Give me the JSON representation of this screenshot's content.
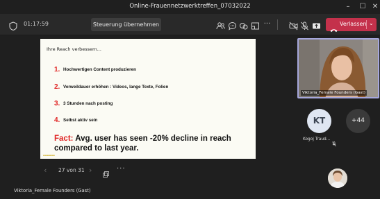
{
  "window": {
    "title": "Online-Frauennetzwerktreffen_07032022",
    "minimize": "–",
    "maximize": "☐",
    "close": "✕"
  },
  "toolbar": {
    "timer": "01:17:59",
    "take_control_label": "Steuerung übernehmen",
    "leave_label": "Verlassen",
    "leave_color": "#c4314b",
    "icons": [
      "people-icon",
      "chat-icon",
      "reactions-icon",
      "rooms-icon",
      "more-icon",
      "camera-off-icon",
      "mic-off-icon",
      "share-icon",
      "phone-icon"
    ]
  },
  "slide": {
    "heading": "Ihre Reach verbessern...",
    "items": [
      {
        "num": "1.",
        "text": "Hochwertigen Content produzieren"
      },
      {
        "num": "2.",
        "text": "Verweildauer erhöhen : Videos, lange Texte, Folien"
      },
      {
        "num": "3.",
        "text": "3 Stunden nach posting"
      },
      {
        "num": "4.",
        "text": "Selbst aktiv sein"
      }
    ],
    "fact_label": "Fact:",
    "fact_text": "Avg. user has seen -20% decline in reach compared to last year.",
    "accent_color": "#e02424"
  },
  "navigation": {
    "pager": "27 von 31"
  },
  "presenter_name": "Viktoria_Female Founders (Gast)",
  "participants": {
    "video_name": "Viktoria_Female Founders (Gast)",
    "kt_initials": "KT",
    "kt_name": "Kogoj Traud...",
    "overflow_count": "+44"
  }
}
